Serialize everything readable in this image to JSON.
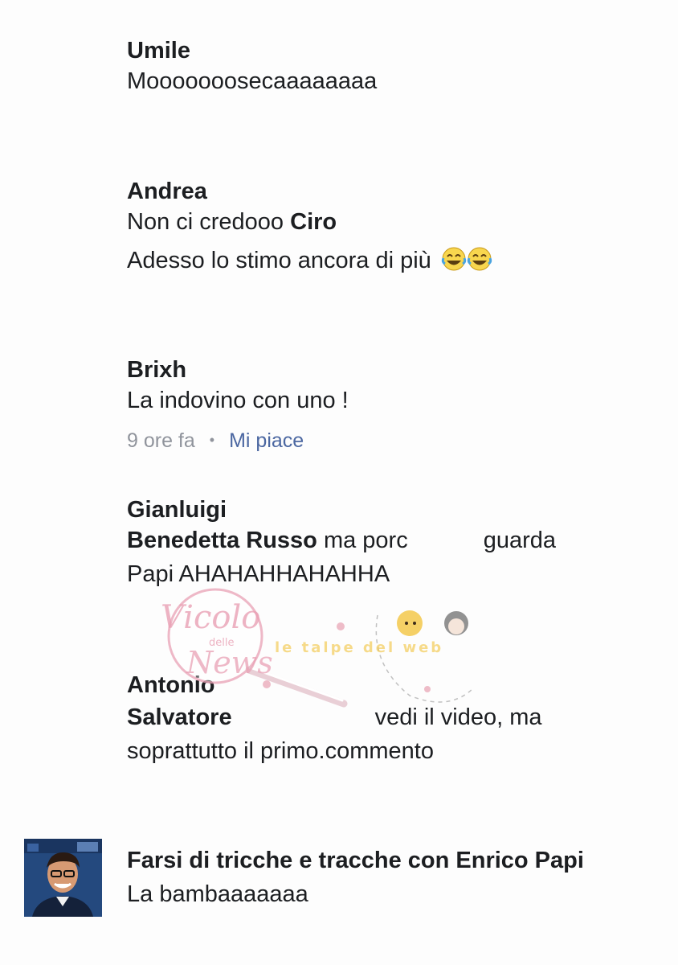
{
  "comments": [
    {
      "author": "Umile",
      "lines": [
        "Mooooooosecaaaaaaaa"
      ]
    },
    {
      "author": "Andrea",
      "line1_text": "Non ci credooo ",
      "line1_mention": "Ciro",
      "line2_text": "Adesso lo stimo ancora di più",
      "emoji": [
        "laughing-tears-emoji",
        "laughing-tears-emoji"
      ]
    },
    {
      "author": "Brixh",
      "lines": [
        "La indovino con uno !"
      ],
      "time": "9 ore fa",
      "like_label": "Mi piace"
    },
    {
      "author": "Gianluigi",
      "mention": "Benedetta Russo",
      "line1_text": " ma porc",
      "line1_tail": "guarda",
      "line2_text": "Papi AHAHAHHAHAHHA"
    },
    {
      "author": "Antonio",
      "mention": "Salvatore",
      "line1_tail": "vedi il video, ma",
      "line2_text": "soprattutto il primo.commento"
    },
    {
      "author": "Farsi di tricche e tracche con Enrico Papi",
      "lines": [
        "La bambaaaaaaa"
      ],
      "avatar_icon": "profile-photo"
    }
  ],
  "watermark": {
    "logo_text_1": "Vicolo",
    "logo_text_2": "delle",
    "logo_text_3": "News",
    "badge_text": "le talpe del web"
  },
  "colors": {
    "text": "#1c1e21",
    "meta": "#90949c",
    "link": "#4b67a1",
    "watermark_pink": "#e8a0b4",
    "watermark_yellow": "#f3c84b"
  }
}
